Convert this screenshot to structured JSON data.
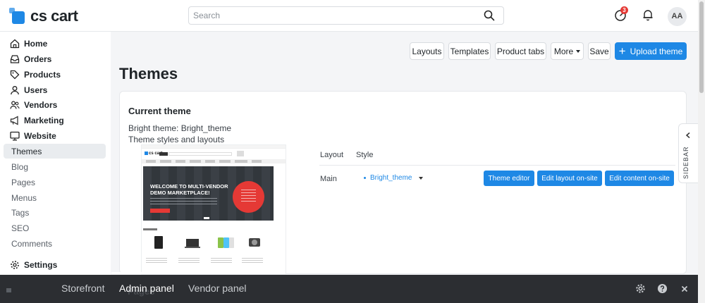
{
  "brand": {
    "logo_text": "cs cart",
    "accent": "#1e88e5"
  },
  "search": {
    "placeholder": "Search"
  },
  "header": {
    "notification_badge": "3",
    "avatar_initials": "AA"
  },
  "sidebar": {
    "items": [
      {
        "label": "Home",
        "icon": "home-icon"
      },
      {
        "label": "Orders",
        "icon": "inbox-icon"
      },
      {
        "label": "Products",
        "icon": "tag-icon"
      },
      {
        "label": "Users",
        "icon": "user-icon"
      },
      {
        "label": "Vendors",
        "icon": "megaphone-icon"
      },
      {
        "label": "Marketing",
        "icon": "bullhorn-icon"
      },
      {
        "label": "Website",
        "icon": "monitor-icon"
      }
    ],
    "sub_items": [
      "Themes",
      "Blog",
      "Pages",
      "Menus",
      "Tags",
      "SEO",
      "Comments"
    ],
    "settings_label": "Settings"
  },
  "toolbar": {
    "layouts": "Layouts",
    "templates": "Templates",
    "product_tabs": "Product tabs",
    "more": "More",
    "save": "Save",
    "upload_theme": "Upload theme"
  },
  "page": {
    "title": "Themes"
  },
  "current_theme": {
    "heading": "Current theme",
    "name": "Bright theme: Bright_theme",
    "description": "Theme styles and layouts",
    "preview": {
      "banner_title": "WELCOME TO MULTI-VENDOR DEMO MARKETPLACE!",
      "logo_text": "cs cart"
    },
    "table": {
      "col_layout": "Layout",
      "col_style": "Style",
      "row_layout": "Main",
      "row_style": "Bright_theme",
      "btn_theme_editor": "Theme editor",
      "btn_edit_layout": "Edit layout on-site",
      "btn_edit_content": "Edit content on-site"
    }
  },
  "side_panel": {
    "label": "SIDEBAR"
  },
  "bottom_bar": {
    "tabs": [
      "Storefront",
      "Admin panel",
      "Vendor panel"
    ],
    "active_tab": "Admin panel",
    "behind_title": "Pages"
  }
}
